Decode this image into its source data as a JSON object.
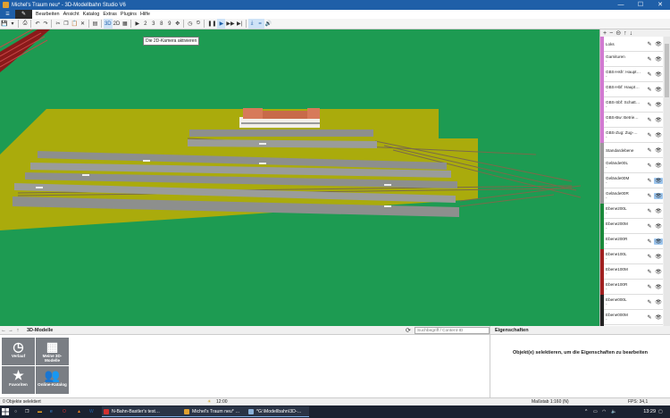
{
  "window": {
    "title": "Michel's Traum neu* - 3D-Modellbahn Studio V6",
    "minimize": "—",
    "maximize": "☐",
    "close": "✕"
  },
  "menu": {
    "file_icon": "save-icon",
    "edit_icon": "pencil-icon",
    "items": [
      "Bearbeiten",
      "Ansicht",
      "Katalog",
      "Extras",
      "Plugins",
      "Hilfe"
    ]
  },
  "toolbar": {
    "view_3d": "3D",
    "view_2d": "2D",
    "nums": [
      "2",
      "3",
      "8",
      "9"
    ],
    "tooltip": "Die 2D-Kamera aktivieren"
  },
  "layers": [
    {
      "name": "Loks",
      "sub": "",
      "color": "#d27ad2"
    },
    {
      "name": "Garnituren",
      "sub": "-",
      "color": "#d27ad2"
    },
    {
      "name": "GBS-Hsfr: Haupt…",
      "sub": "-",
      "color": "#d27ad2"
    },
    {
      "name": "GBS-Hbf: Haupt…",
      "sub": "-",
      "color": "#d27ad2"
    },
    {
      "name": "GBS-Sbf: Schatt…",
      "sub": "-",
      "color": "#d27ad2"
    },
    {
      "name": "GBS-Bw: Betrie…",
      "sub": "-",
      "color": "#d27ad2"
    },
    {
      "name": "GBS-Zug: Zug-…",
      "sub": "-",
      "color": "#d27ad2"
    },
    {
      "name": "Standardebene",
      "sub": "",
      "color": "#9a9a9a"
    },
    {
      "name": "Gelände00L",
      "sub": "-",
      "color": "#9a9a9a"
    },
    {
      "name": "Gelände00M",
      "sub": "-",
      "color": "#9a9a9a"
    },
    {
      "name": "Gelände00R",
      "sub": "-",
      "color": "#9a9a9a"
    },
    {
      "name": "Ebene200L",
      "sub": "-",
      "color": "#1a8a3a"
    },
    {
      "name": "Ebene200M",
      "sub": "-",
      "color": "#1a8a3a"
    },
    {
      "name": "Ebene200R",
      "sub": "-",
      "color": "#1a8a3a"
    },
    {
      "name": "Ebene100L",
      "sub": "-",
      "color": "#a02020"
    },
    {
      "name": "Ebene100M",
      "sub": "-",
      "color": "#a02020"
    },
    {
      "name": "Ebene100R",
      "sub": "-",
      "color": "#a02020"
    },
    {
      "name": "Ebene000L",
      "sub": "-",
      "color": "#222222"
    },
    {
      "name": "Ebene000M",
      "sub": "-",
      "color": "#222222"
    },
    {
      "name": "Ebene000R",
      "sub": "-",
      "color": "#222222"
    },
    {
      "name": "Hbf-Gleise",
      "sub": "-",
      "color": "#2a8ad0"
    },
    {
      "name": "Hbf-Gleisbau…",
      "sub": "",
      "color": "#2a8ad0"
    }
  ],
  "bottom": {
    "title": "3D-Modelle",
    "search_placeholder": "Suchbegriff / Content-ID",
    "tiles": [
      "Verlauf",
      "Meine 3D-Modelle",
      "Favoriten",
      "Online-Katalog"
    ],
    "props_title": "Eigenschaften",
    "props_message": "Objekt(e) selektieren, um die Eigenschaften zu bearbeiten"
  },
  "status": {
    "left": "0 Objekte selektiert",
    "time": "12:00",
    "scale": "Maßstab 1:160 (N)",
    "fps": "FPS: 34,1"
  },
  "taskbar": {
    "apps": [
      "N-Bahn-Bastler's test…",
      "Michel's Traum neu* …",
      "*G:\\Modellbahn\\3D-…"
    ],
    "clock": "13:29"
  }
}
